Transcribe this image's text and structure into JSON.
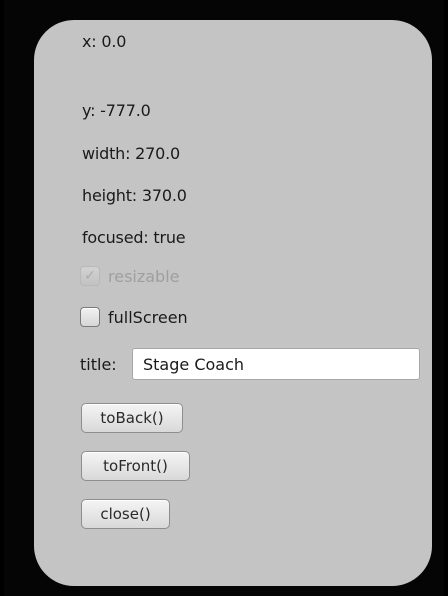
{
  "props": {
    "x_text": "x: 0.0",
    "y_text": "y: -777.0",
    "width_text": "width: 270.0",
    "height_text": "height: 370.0",
    "focused_text": "focused: true"
  },
  "checkboxes": {
    "resizable": {
      "label": "resizable",
      "checked": true,
      "enabled": false,
      "check_glyph": "✓"
    },
    "fullscreen": {
      "label": "fullScreen",
      "checked": false,
      "enabled": true
    }
  },
  "title_field": {
    "label": "title:",
    "value": "Stage Coach"
  },
  "buttons": {
    "to_back": "toBack()",
    "to_front": "toFront()",
    "close": "close()"
  }
}
